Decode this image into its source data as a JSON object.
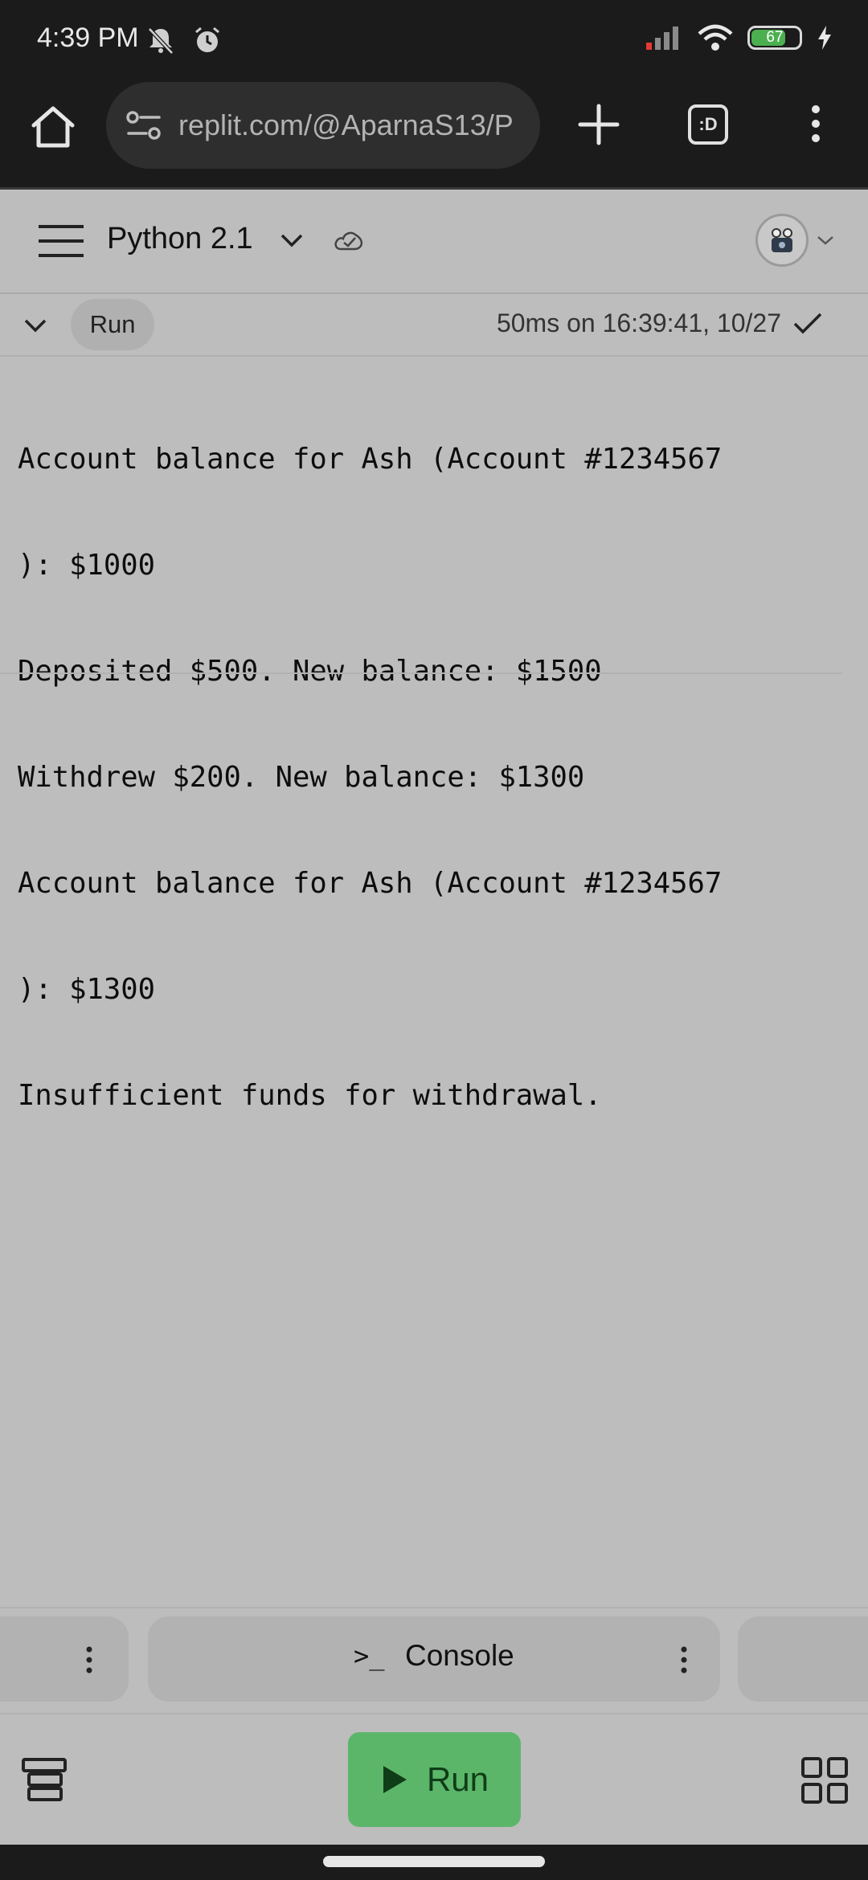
{
  "status_bar": {
    "time": "4:39 PM",
    "battery_percent": "67",
    "battery_level": 0.67,
    "icons": [
      "mute-bell-icon",
      "alarm-icon",
      "signal-icon",
      "wifi-icon",
      "battery-icon",
      "charging-icon"
    ]
  },
  "browser": {
    "url": "replit.com/@AparnaS13/P",
    "tabs_label": ":D"
  },
  "repl": {
    "title": "Python 2.1"
  },
  "run_row": {
    "run_label": "Run",
    "meta": "50ms on 16:39:41, 10/27"
  },
  "output_lines": [
    "Account balance for Ash (Account #1234567",
    "): $1000",
    "Deposited $500. New balance: $1500",
    "Withdrew $200. New balance: $1300",
    "Account balance for Ash (Account #1234567",
    "): $1300",
    "Insufficient funds for withdrawal."
  ],
  "panes": {
    "console_prompt": ">_",
    "console_label": "Console"
  },
  "toolbar": {
    "run_label": "Run"
  },
  "colors": {
    "run_button": "#5cb66a",
    "background": "#bdbdbd",
    "system_bar": "#1b1b1b"
  }
}
